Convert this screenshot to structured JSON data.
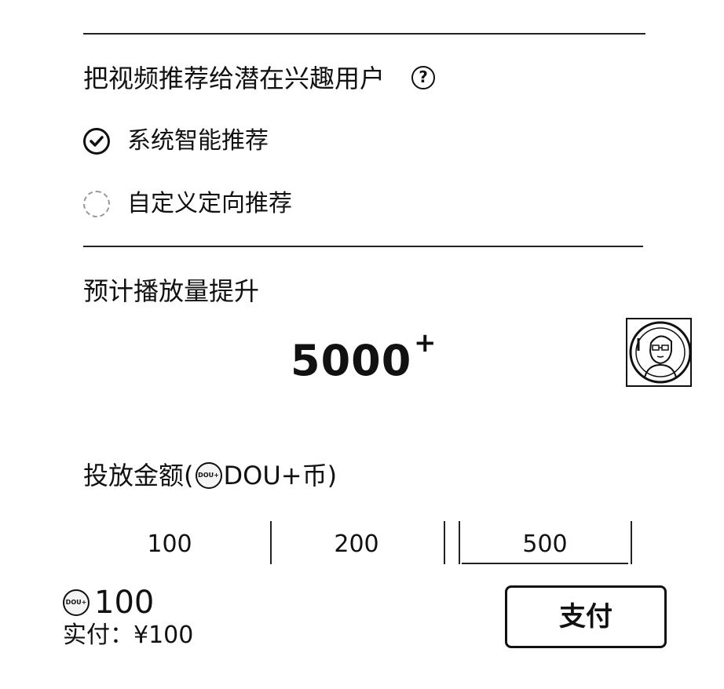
{
  "targeting": {
    "title": "把视频推荐给潜在兴趣用户",
    "help_icon_glyph": "?",
    "options": [
      {
        "label": "系统智能推荐",
        "selected": true
      },
      {
        "label": "自定义定向推荐",
        "selected": false
      }
    ]
  },
  "estimate": {
    "title": "预计播放量提升",
    "value": "5000",
    "suffix": "+"
  },
  "amount": {
    "title_prefix": "投放金额(",
    "coin_label": "DOU+币)",
    "coin_icon_text": "DOU+",
    "options": [
      "100",
      "200",
      "500"
    ],
    "selected": "500"
  },
  "footer": {
    "total": "100",
    "actual_pay": "实付：¥100",
    "pay_label": "支付"
  },
  "icons": {
    "help": "question-circle-icon",
    "checked": "check-circle-icon",
    "unchecked": "empty-circle-icon",
    "coin": "dou-coin-icon",
    "avatar": "user-avatar"
  }
}
